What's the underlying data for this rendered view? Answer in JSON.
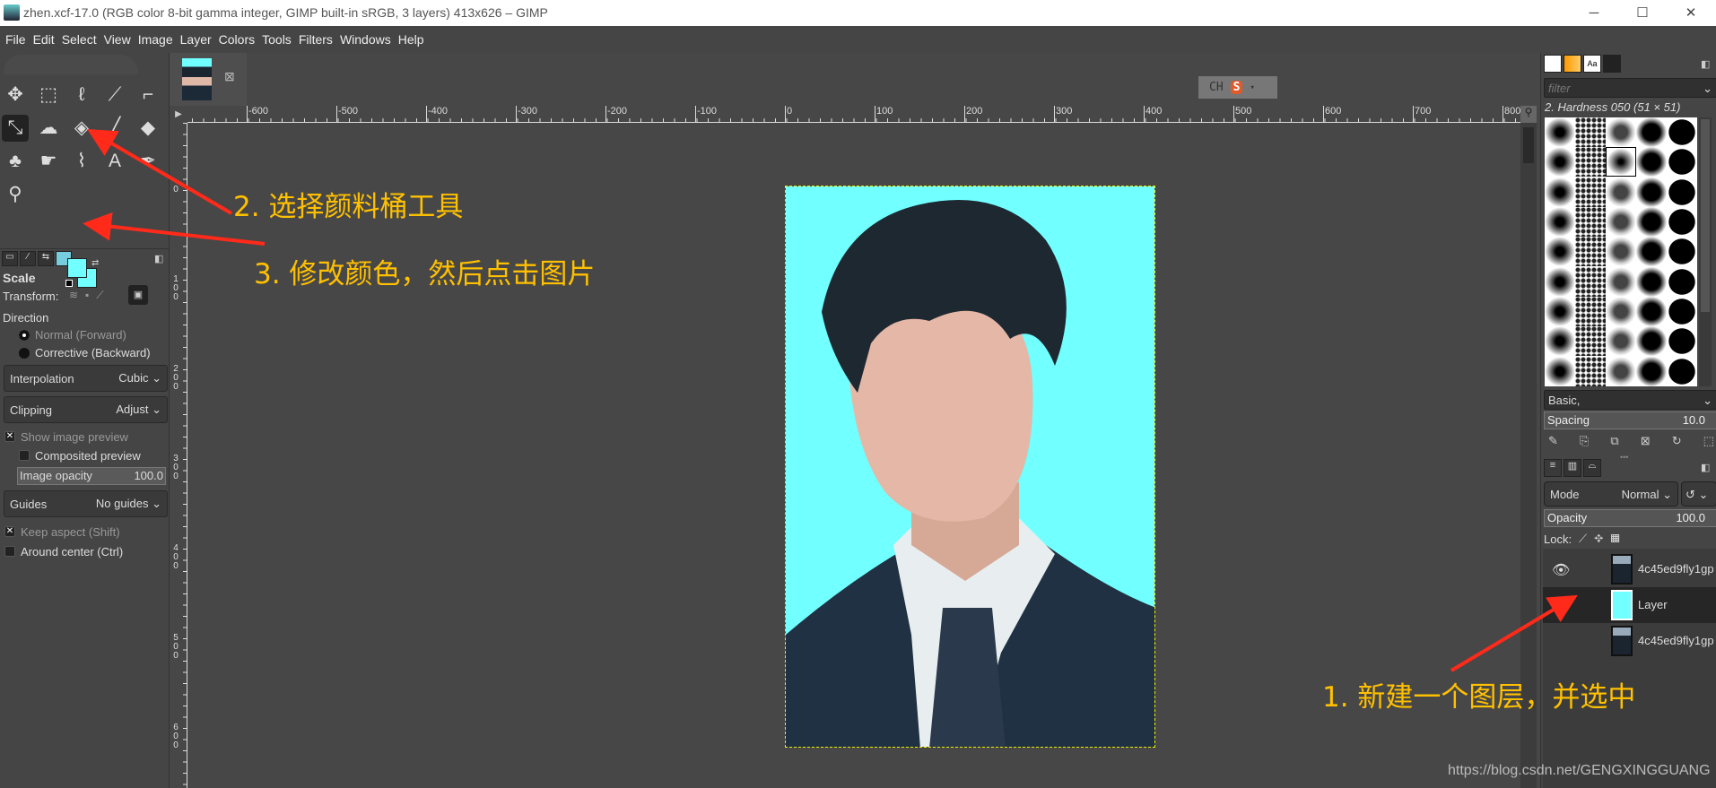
{
  "window": {
    "title": "zhen.xcf-17.0 (RGB color 8-bit gamma integer, GIMP built-in sRGB, 3 layers) 413x626 – GIMP",
    "minimize": "─",
    "maximize": "☐",
    "close": "✕"
  },
  "menu": [
    "File",
    "Edit",
    "Select",
    "View",
    "Image",
    "Layer",
    "Colors",
    "Tools",
    "Filters",
    "Windows",
    "Help"
  ],
  "toolbox": {
    "tools": [
      {
        "name": "move-tool-icon",
        "glyph": "✥"
      },
      {
        "name": "rect-select-tool-icon",
        "glyph": "⬚"
      },
      {
        "name": "lasso-tool-icon",
        "glyph": "ℓ"
      },
      {
        "name": "fuzzy-select-tool-icon",
        "glyph": "⟋"
      },
      {
        "name": "crop-tool-icon",
        "glyph": "⌐"
      },
      {
        "name": "unified-transform-tool-icon",
        "glyph": "⤡"
      },
      {
        "name": "warp-tool-icon",
        "glyph": "☁"
      },
      {
        "name": "bucket-fill-tool-icon",
        "glyph": "◈"
      },
      {
        "name": "paintbrush-tool-icon",
        "glyph": "╱"
      },
      {
        "name": "eraser-tool-icon",
        "glyph": "◆"
      },
      {
        "name": "clone-tool-icon",
        "glyph": "♣"
      },
      {
        "name": "smudge-tool-icon",
        "glyph": "☛"
      },
      {
        "name": "paths-tool-icon",
        "glyph": "⌇"
      },
      {
        "name": "text-tool-icon",
        "glyph": "A"
      },
      {
        "name": "color-picker-tool-icon",
        "glyph": "✒"
      },
      {
        "name": "zoom-tool-icon",
        "glyph": "⚲"
      }
    ],
    "fg_color": "#71ffff",
    "bg_color": "#71ffff"
  },
  "tool_options": {
    "title": "Scale",
    "transform_label": "Transform:",
    "direction_label": "Direction",
    "normal": "Normal (Forward)",
    "corrective": "Corrective (Backward)",
    "interpolation_label": "Interpolation",
    "interpolation_value": "Cubic",
    "clipping_label": "Clipping",
    "clipping_value": "Adjust",
    "show_preview": "Show image preview",
    "composited_preview": "Composited preview",
    "image_opacity_label": "Image opacity",
    "image_opacity_value": "100.0",
    "guides_label": "Guides",
    "guides_value": "No guides",
    "keep_aspect": "Keep aspect (Shift)",
    "around_center": "Around center (Ctrl)"
  },
  "image_tab": {
    "close": "⊠"
  },
  "ime": {
    "label": "CH",
    "logo": "S"
  },
  "rulers": {
    "h": [
      "-600",
      "-500",
      "-400",
      "-300",
      "-200",
      "-100",
      "0",
      "100",
      "200",
      "300",
      "400",
      "500",
      "600",
      "700",
      "800"
    ],
    "v": [
      "0",
      "100",
      "200",
      "300",
      "400",
      "500",
      "600"
    ]
  },
  "canvas": {
    "bg_color": "#71ffff"
  },
  "brushes": {
    "filter_placeholder": "filter",
    "selected": "2. Hardness 050 (51 × 51)",
    "tag": "Basic,",
    "spacing_label": "Spacing",
    "spacing_value": "10.0"
  },
  "layers": {
    "mode_label": "Mode",
    "mode_value": "Normal",
    "opacity_label": "Opacity",
    "opacity_value": "100.0",
    "lock_label": "Lock:",
    "items": [
      {
        "name": "4c45ed9fly1gp",
        "visible": true
      },
      {
        "name": "Layer",
        "visible": true,
        "selected": true
      },
      {
        "name": "4c45ed9fly1gp",
        "visible": false
      }
    ]
  },
  "annotations": {
    "step1": "1. 新建一个图层，并选中",
    "step2": "2. 选择颜料桶工具",
    "step3": "3. 修改颜色，然后点击图片"
  },
  "watermark": "https://blog.csdn.net/GENGXINGGUANG"
}
